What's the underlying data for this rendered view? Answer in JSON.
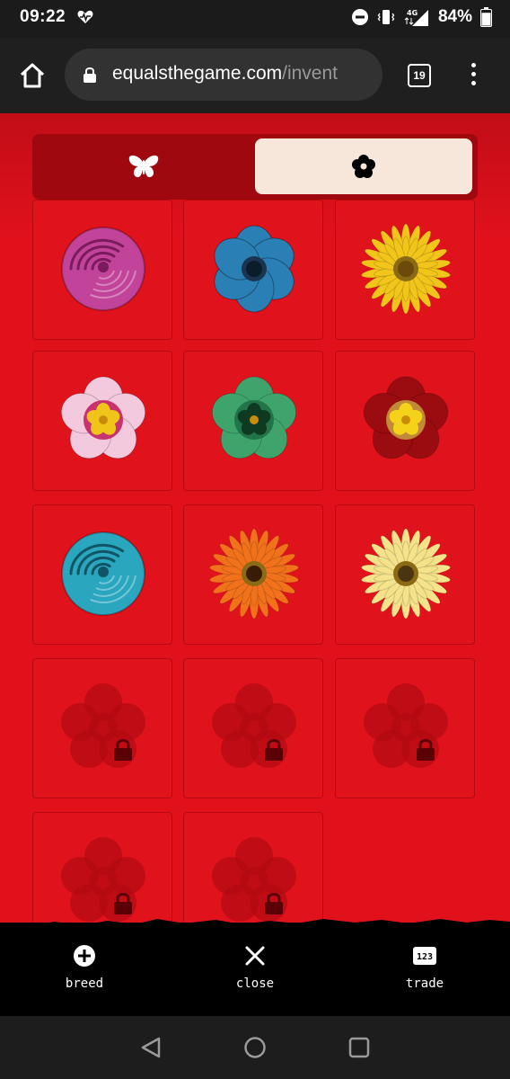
{
  "status_bar": {
    "time": "09:22",
    "network": "4G",
    "battery_percent": "84%",
    "battery_level": 0.84
  },
  "browser": {
    "url_domain": "equalsthegame.com",
    "url_path": "/invent",
    "tab_count": "19"
  },
  "toggle": {
    "options": [
      "butterfly",
      "flower"
    ],
    "selected": "flower"
  },
  "inventory": {
    "items": [
      {
        "kind": "rose",
        "color": "#c2449a",
        "center": "#7b1b5e",
        "locked": false
      },
      {
        "kind": "anemone",
        "color": "#2a7fb5",
        "center": "#0b1c2b",
        "locked": false
      },
      {
        "kind": "gerbera",
        "color": "#f2c51a",
        "center": "#6b4a0a",
        "locked": false
      },
      {
        "kind": "primrose",
        "color": "#f3c9dd",
        "center": "#f0c419",
        "ring": "#c0185c",
        "locked": false
      },
      {
        "kind": "primrose",
        "color": "#3fa46c",
        "center": "#0f3a22",
        "ring": "#1e6b42",
        "locked": false
      },
      {
        "kind": "primrose",
        "color": "#9a0c10",
        "center": "#f5d21a",
        "ring": "#c9a040",
        "locked": false
      },
      {
        "kind": "rose",
        "color": "#2aa7bf",
        "center": "#0f5566",
        "locked": false
      },
      {
        "kind": "gerbera",
        "color": "#f2721c",
        "center": "#3a1c06",
        "locked": false
      },
      {
        "kind": "gerbera",
        "color": "#f4e38a",
        "center": "#4a3510",
        "locked": false
      },
      {
        "kind": "placeholder",
        "locked": true
      },
      {
        "kind": "placeholder",
        "locked": true
      },
      {
        "kind": "placeholder",
        "locked": true
      },
      {
        "kind": "placeholder",
        "locked": true
      },
      {
        "kind": "placeholder",
        "locked": true
      }
    ]
  },
  "bottom_bar": {
    "breed_label": "breed",
    "close_label": "close",
    "trade_label": "trade",
    "trade_icon_text": "123"
  },
  "colors": {
    "game_bg": "#e1111c",
    "toggle_bg": "#a00810",
    "toggle_selected": "#f7e6da",
    "locked_icon": "#b20a12"
  }
}
